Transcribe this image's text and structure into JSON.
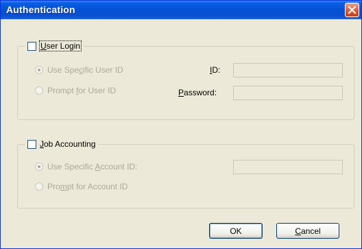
{
  "window": {
    "title": "Authentication"
  },
  "user_login": {
    "label_u": "U",
    "label_rest": "ser Login",
    "use_specific_pre": "Use Spe",
    "use_specific_u": "c",
    "use_specific_post": "ific User ID",
    "prompt_pre": "Prompt ",
    "prompt_u": "f",
    "prompt_post": "or User ID",
    "id_u": "I",
    "id_post": "D:",
    "password_u": "P",
    "password_post": "assword:",
    "id_value": "",
    "password_value": ""
  },
  "job_accounting": {
    "label_u": "J",
    "label_rest": "ob Accounting",
    "use_specific_pre": "Use Specific ",
    "use_specific_u": "A",
    "use_specific_post": "ccount ID:",
    "prompt_pre": "Pro",
    "prompt_u": "m",
    "prompt_post": "pt for Account ID",
    "account_value": ""
  },
  "buttons": {
    "ok": "OK",
    "cancel_u": "C",
    "cancel_post": "ancel"
  },
  "icons": {
    "close": "close-icon"
  }
}
